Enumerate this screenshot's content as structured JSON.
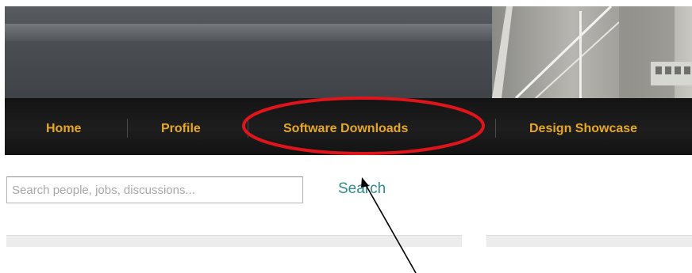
{
  "nav": {
    "items": [
      {
        "label": "Home"
      },
      {
        "label": "Profile"
      },
      {
        "label": "Software Downloads"
      },
      {
        "label": "Design Showcase"
      }
    ]
  },
  "search": {
    "placeholder": "Search people, jobs, discussions...",
    "button_label": "Search"
  },
  "colors": {
    "nav_text": "#e7a726",
    "nav_background": "#181818",
    "search_link": "#2f8c8c",
    "highlight_ellipse": "#e0141b"
  }
}
